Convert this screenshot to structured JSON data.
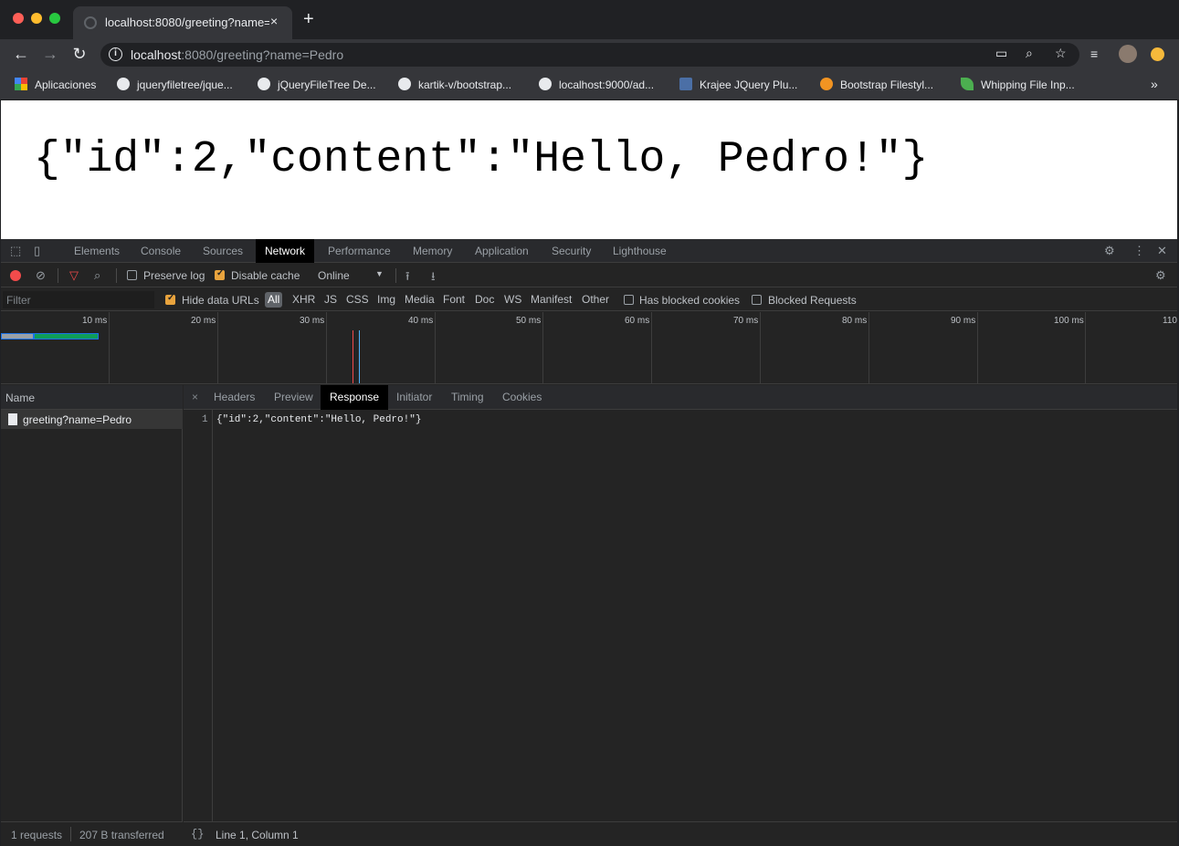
{
  "browser": {
    "tab_title": "localhost:8080/greeting?name=Pedro",
    "tab_close": "×",
    "new_tab": "+",
    "url_host": "localhost",
    "url_path": ":8080/greeting?name=Pedro",
    "bookmarks": [
      {
        "label": "Aplicaciones",
        "icon": "apps-grid-icon"
      },
      {
        "label": "jqueryfiletree/jque...",
        "icon": "github-icon"
      },
      {
        "label": "jQueryFileTree De...",
        "icon": "globe-icon"
      },
      {
        "label": "kartik-v/bootstrap...",
        "icon": "github-icon"
      },
      {
        "label": "localhost:9000/ad...",
        "icon": "globe-icon"
      },
      {
        "label": "Krajee JQuery Plu...",
        "icon": "krajee-icon"
      },
      {
        "label": "Bootstrap Filestyl...",
        "icon": "orange-icon"
      },
      {
        "label": "Whipping File Inp...",
        "icon": "leaf-icon"
      }
    ],
    "bookmarks_more": "»"
  },
  "page": {
    "json_text": "{\"id\":2,\"content\":\"Hello, Pedro!\"}"
  },
  "devtools": {
    "tabs": [
      "Elements",
      "Console",
      "Sources",
      "Network",
      "Performance",
      "Memory",
      "Application",
      "Security",
      "Lighthouse"
    ],
    "active_tab": "Network",
    "network": {
      "preserve_log": "Preserve log",
      "disable_cache": "Disable cache",
      "throttling": "Online",
      "filter_placeholder": "Filter",
      "hide_data_urls": "Hide data URLs",
      "types": [
        "All",
        "XHR",
        "JS",
        "CSS",
        "Img",
        "Media",
        "Font",
        "Doc",
        "WS",
        "Manifest",
        "Other"
      ],
      "active_type": "All",
      "has_blocked_cookies": "Has blocked cookies",
      "blocked_requests": "Blocked Requests",
      "timeline_labels": [
        "10 ms",
        "20 ms",
        "30 ms",
        "40 ms",
        "50 ms",
        "60 ms",
        "70 ms",
        "80 ms",
        "90 ms",
        "100 ms",
        "110"
      ],
      "name_column": "Name",
      "requests": [
        {
          "name": "greeting?name=Pedro"
        }
      ],
      "footer_requests": "1 requests",
      "footer_transferred": "207 B transferred"
    },
    "detail": {
      "close": "×",
      "tabs": [
        "Headers",
        "Preview",
        "Response",
        "Initiator",
        "Timing",
        "Cookies"
      ],
      "active_tab": "Response",
      "line_number": "1",
      "response_body": "{\"id\":2,\"content\":\"Hello, Pedro!\"}",
      "pretty_print": "{}",
      "cursor_position": "Line 1, Column 1"
    }
  }
}
